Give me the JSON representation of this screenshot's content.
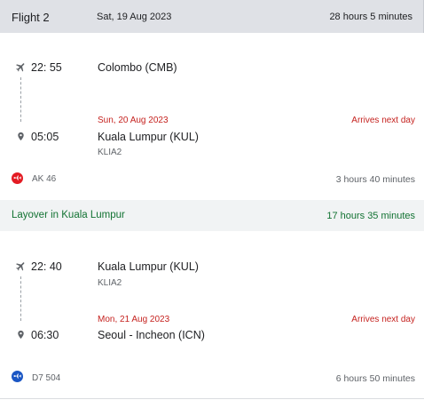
{
  "header": {
    "flight_label": "Flight 2",
    "date": "Sat, 19 Aug 2023",
    "total_duration": "28 hours 5 minutes"
  },
  "legs": [
    {
      "depart_time": "22: 55",
      "depart_place": "Colombo (CMB)",
      "arrive_date": "Sun, 20 Aug 2023",
      "arrives_next_day": "Arrives next day",
      "arrive_time": "05:05",
      "arrive_place": "Kuala Lumpur (KUL)",
      "arrive_terminal": "KLIA2",
      "flight_number": "AK 46",
      "duration": "3 hours 40 minutes",
      "airline_color": "#e31b23"
    },
    {
      "depart_time": "22: 40",
      "depart_place": "Kuala Lumpur (KUL)",
      "depart_terminal": "KLIA2",
      "arrive_date": "Mon, 21 Aug 2023",
      "arrives_next_day": "Arrives next day",
      "arrive_time": "06:30",
      "arrive_place": "Seoul - Incheon (ICN)",
      "flight_number": "D7 504",
      "duration": "6 hours 50 minutes",
      "airline_color": "#1a56c4"
    }
  ],
  "layover": {
    "label": "Layover in Kuala Lumpur",
    "duration": "17 hours 35 minutes"
  },
  "colors": {
    "accent_red": "#c5221f",
    "layover_green": "#137333",
    "header_bg": "#dfe1e6"
  },
  "icons": [
    "plane-icon",
    "location-pin-icon",
    "airline-logo-icon"
  ]
}
